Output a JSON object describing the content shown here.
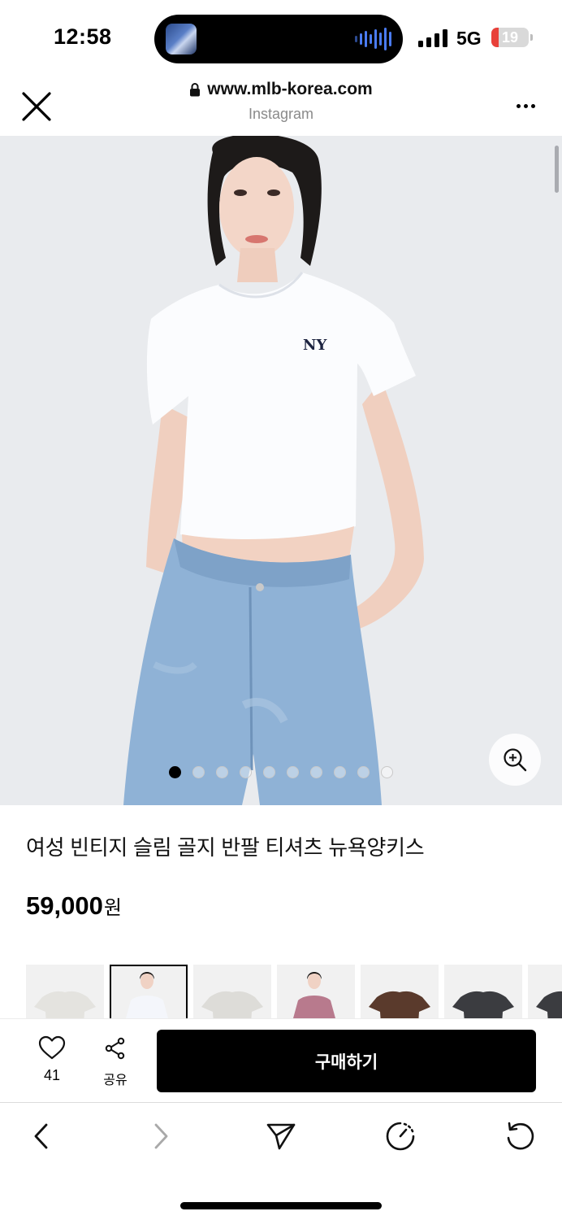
{
  "status_bar": {
    "time": "12:58",
    "network": "5G",
    "battery_level": "19",
    "battery_fraction": 0.19,
    "battery_color": "#e8413a"
  },
  "browser": {
    "url": "www.mlb-korea.com",
    "source": "Instagram",
    "close_icon": "close-icon",
    "more_icon": "more-icon"
  },
  "gallery": {
    "image_count": 10,
    "current_index": 1,
    "zoom_icon": "zoom-in-icon",
    "background": "#e9ebee"
  },
  "product": {
    "name": "여성 빈티지 슬림 골지 반팔 티셔츠 뉴욕양키스",
    "price": "59,000",
    "currency": "원"
  },
  "color_options": [
    {
      "name": "light-gray",
      "color": "#e4e3df",
      "selected": false
    },
    {
      "name": "white-model",
      "color": "#f4f6fb",
      "selected": true
    },
    {
      "name": "light-gray-2",
      "color": "#dddcd8",
      "selected": false
    },
    {
      "name": "pink-model",
      "color": "#b87a8d",
      "selected": false
    },
    {
      "name": "brown",
      "color": "#5a3a2c",
      "selected": false
    },
    {
      "name": "charcoal",
      "color": "#3b3c40",
      "selected": false
    },
    {
      "name": "charcoal-2",
      "color": "#3b3c40",
      "selected": false
    }
  ],
  "actions": {
    "like_count": "41",
    "share_label": "공유",
    "buy_label": "구매하기"
  },
  "toolbar": {
    "items": [
      "back-icon",
      "forward-icon",
      "send-icon",
      "timer-icon",
      "refresh-icon"
    ]
  }
}
